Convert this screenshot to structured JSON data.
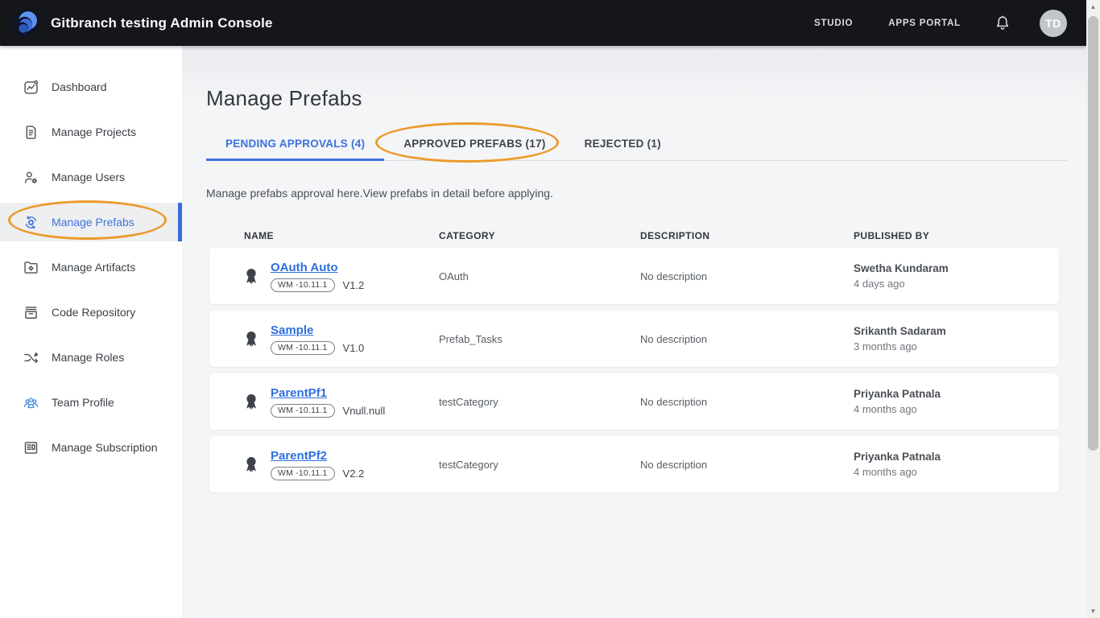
{
  "header": {
    "title": "Gitbranch testing Admin Console",
    "nav": [
      {
        "label": "STUDIO"
      },
      {
        "label": "APPS PORTAL"
      }
    ],
    "bell_icon": "bell-icon",
    "avatar_initials": "TD"
  },
  "sidebar": {
    "items": [
      {
        "label": "Dashboard",
        "icon": "dashboard-icon",
        "active": false
      },
      {
        "label": "Manage Projects",
        "icon": "projects-icon",
        "active": false
      },
      {
        "label": "Manage Users",
        "icon": "users-icon",
        "active": false
      },
      {
        "label": "Manage Prefabs",
        "icon": "prefabs-icon",
        "active": true
      },
      {
        "label": "Manage Artifacts",
        "icon": "artifacts-icon",
        "active": false
      },
      {
        "label": "Code Repository",
        "icon": "repository-icon",
        "active": false
      },
      {
        "label": "Manage Roles",
        "icon": "roles-icon",
        "active": false
      },
      {
        "label": "Team Profile",
        "icon": "team-icon",
        "active": false
      },
      {
        "label": "Manage Subscription",
        "icon": "subscription-icon",
        "active": false
      }
    ]
  },
  "main": {
    "page_title": "Manage Prefabs",
    "tabs": [
      {
        "label": "PENDING APPROVALS (4)",
        "active": true
      },
      {
        "label": "APPROVED PREFABS (17)",
        "active": false
      },
      {
        "label": "REJECTED (1)",
        "active": false
      }
    ],
    "description": "Manage prefabs approval here.View prefabs in detail before applying.",
    "table": {
      "columns": [
        "NAME",
        "CATEGORY",
        "DESCRIPTION",
        "PUBLISHED BY"
      ],
      "rows": [
        {
          "name": "OAuth Auto",
          "wm_badge": "WM -10.11.1",
          "version": "V1.2",
          "category": "OAuth",
          "description": "No description",
          "publisher": "Swetha Kundaram",
          "published_time": "4 days ago"
        },
        {
          "name": "Sample",
          "wm_badge": "WM -10.11.1",
          "version": "V1.0",
          "category": "Prefab_Tasks",
          "description": "No description",
          "publisher": "Srikanth Sadaram",
          "published_time": "3 months ago"
        },
        {
          "name": "ParentPf1",
          "wm_badge": "WM -10.11.1",
          "version": "Vnull.null",
          "category": "testCategory",
          "description": "No description",
          "publisher": "Priyanka Patnala",
          "published_time": "4 months ago"
        },
        {
          "name": "ParentPf2",
          "wm_badge": "WM -10.11.1",
          "version": "V2.2",
          "category": "testCategory",
          "description": "No description",
          "publisher": "Priyanka Patnala",
          "published_time": "4 months ago"
        }
      ]
    }
  },
  "annotations": {
    "highlight_color": "#EC9A2A",
    "highlighted_elements": [
      "tab-pending-approvals",
      "sidebar-item-manage-prefabs"
    ]
  },
  "colors": {
    "header_bg": "#141619",
    "accent_blue": "#3B71DD",
    "link_blue": "#2F6FDE",
    "content_bg": "#F4F5F7",
    "sidebar_bg": "#FFFFFF"
  }
}
